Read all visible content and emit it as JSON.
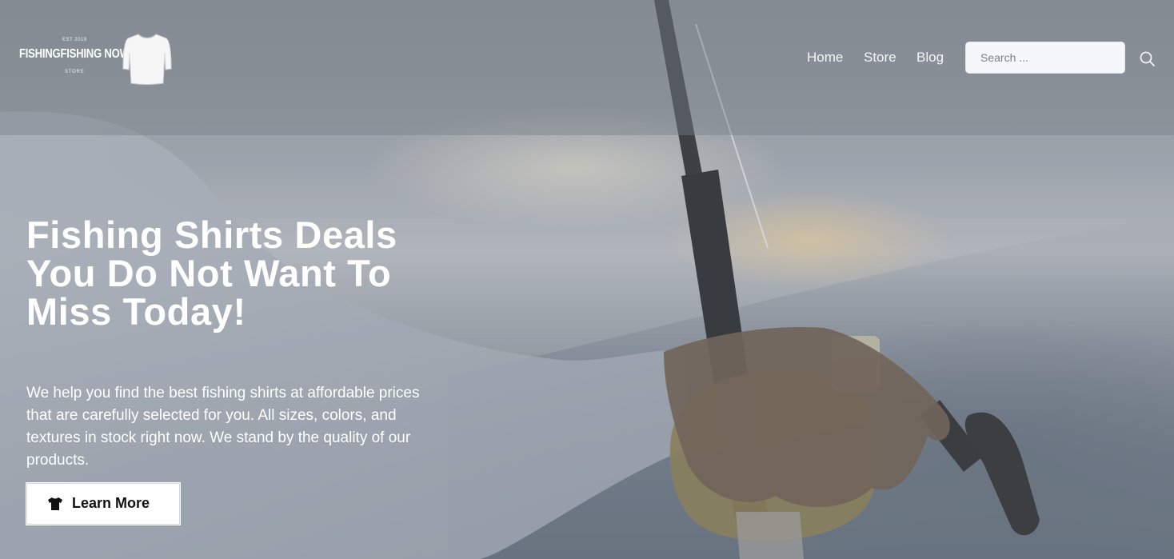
{
  "brand": {
    "est": "EST 2019",
    "name": "FISHINGFISHING NOW",
    "tagline": "STORE"
  },
  "nav": {
    "items": [
      {
        "label": "Home"
      },
      {
        "label": "Store"
      },
      {
        "label": "Blog"
      }
    ]
  },
  "search": {
    "placeholder": "Search ...",
    "value": "",
    "icon": "magnifier-icon"
  },
  "hero": {
    "headline": "Fishing Shirts Deals You Do Not Want To Miss Today!",
    "description": "We help you find the best fishing shirts at affordable prices that are carefully selected for you. All sizes, colors, and textures in stock right now. We stand by the quality of our products.",
    "cta_label": "Learn More",
    "cta_icon": "tshirt-icon"
  },
  "colors": {
    "header_overlay": "#7e848c",
    "text": "#ffffff",
    "cta_background": "#ffffff",
    "cta_text": "#111111"
  }
}
